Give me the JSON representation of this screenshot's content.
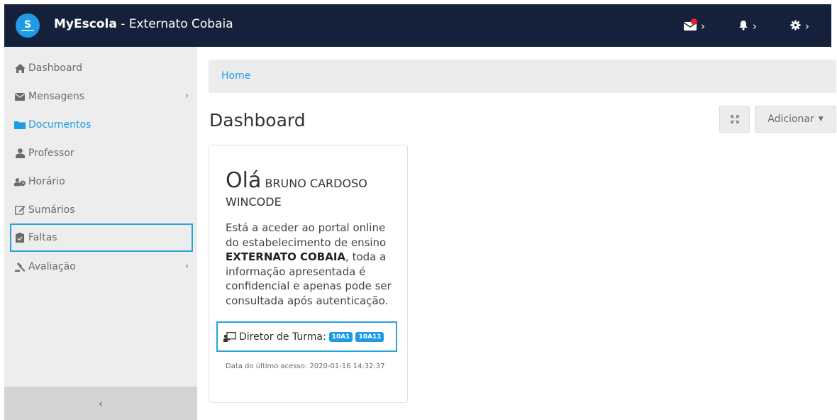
{
  "topbar": {
    "brand_strong": "MyEscola",
    "brand_rest": " - Externato Cobaia",
    "icons": [
      "envelope-icon",
      "bell-icon",
      "gear-icon"
    ],
    "accent": "#15213a",
    "notification_color": "#e3232b"
  },
  "sidebar": {
    "items": [
      {
        "label": "Dashboard",
        "icon": "home-icon"
      },
      {
        "label": "Mensagens",
        "icon": "envelope-icon",
        "has_submenu": true
      },
      {
        "label": "Documentos",
        "icon": "folder-icon",
        "active": true
      },
      {
        "label": "Professor",
        "icon": "user-tie-icon"
      },
      {
        "label": "Horário",
        "icon": "users-clock-icon"
      },
      {
        "label": "Sumários",
        "icon": "edit-icon"
      },
      {
        "label": "Faltas",
        "icon": "clipboard-check-icon"
      },
      {
        "label": "Avaliação",
        "icon": "gavel-icon",
        "has_submenu": true
      }
    ],
    "collapse_label": "‹"
  },
  "breadcrumb": {
    "home": "Home"
  },
  "header": {
    "title": "Dashboard",
    "add_label": "Adicionar"
  },
  "card": {
    "greeting": "Olá",
    "name_line1": "BRUNO CARDOSO",
    "name_line2": "WINCODE",
    "message_pre": "Está a aceder ao portal online do estabelecimento de ensino ",
    "message_school": "EXTERNATO COBAIA",
    "message_post": ", toda a informação apresentada é confidencial e apenas pode ser consultada após autenticação.",
    "director_label": "Diretor de Turma:",
    "classes": [
      "10A1",
      "10A11"
    ],
    "last_access": "Data do último acesso: 2020-01-16 14:32:37"
  },
  "colors": {
    "accent_blue": "#1e9be5",
    "highlight_border": "#2aa3d8",
    "sidebar_bg": "#ededee"
  }
}
